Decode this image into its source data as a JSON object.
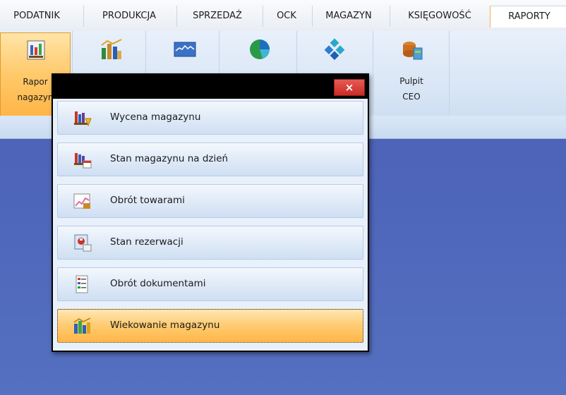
{
  "tabs": [
    {
      "label": "PODATNIK"
    },
    {
      "label": "PRODUKCJA"
    },
    {
      "label": "SPRZEDAŻ"
    },
    {
      "label": "OCK"
    },
    {
      "label": "MAGAZYN"
    },
    {
      "label": "KSIĘGOWOŚĆ"
    },
    {
      "label": "RAPORTY"
    }
  ],
  "active_tab": "RAPORTY",
  "ribbon": {
    "buttons": [
      {
        "line1": "Rapor",
        "line2": "nagazyn",
        "icon": "warehouse-report-icon",
        "active": true
      },
      {
        "line1": "",
        "line2": "",
        "icon": "sales-chart-icon"
      },
      {
        "line1": "",
        "line2": "",
        "icon": "line-graph-icon"
      },
      {
        "line1": "",
        "line2": "",
        "icon": "globe-pie-icon"
      },
      {
        "line1": "",
        "line2": "",
        "icon": "cubes-icon"
      },
      {
        "line1": "Pulpit",
        "line2": "CEO",
        "icon": "dashboard-ceo-icon"
      }
    ]
  },
  "dialog": {
    "close_label": "×",
    "items": [
      {
        "label": "Wycena magazynu",
        "icon": "warehouse-valuation-icon"
      },
      {
        "label": "Stan magazynu na dzień",
        "icon": "stock-on-date-icon"
      },
      {
        "label": "Obrót towarami",
        "icon": "goods-turnover-icon"
      },
      {
        "label": "Stan rezerwacji",
        "icon": "reservation-status-icon"
      },
      {
        "label": "Obrót dokumentami",
        "icon": "document-turnover-icon"
      },
      {
        "label": "Wiekowanie magazynu",
        "icon": "stock-aging-icon",
        "selected": true
      }
    ]
  },
  "colors": {
    "desktop_blue": "#4d64b8",
    "ribbon_blue": "#dbe7f6",
    "highlight_orange": "#ffc96a"
  }
}
